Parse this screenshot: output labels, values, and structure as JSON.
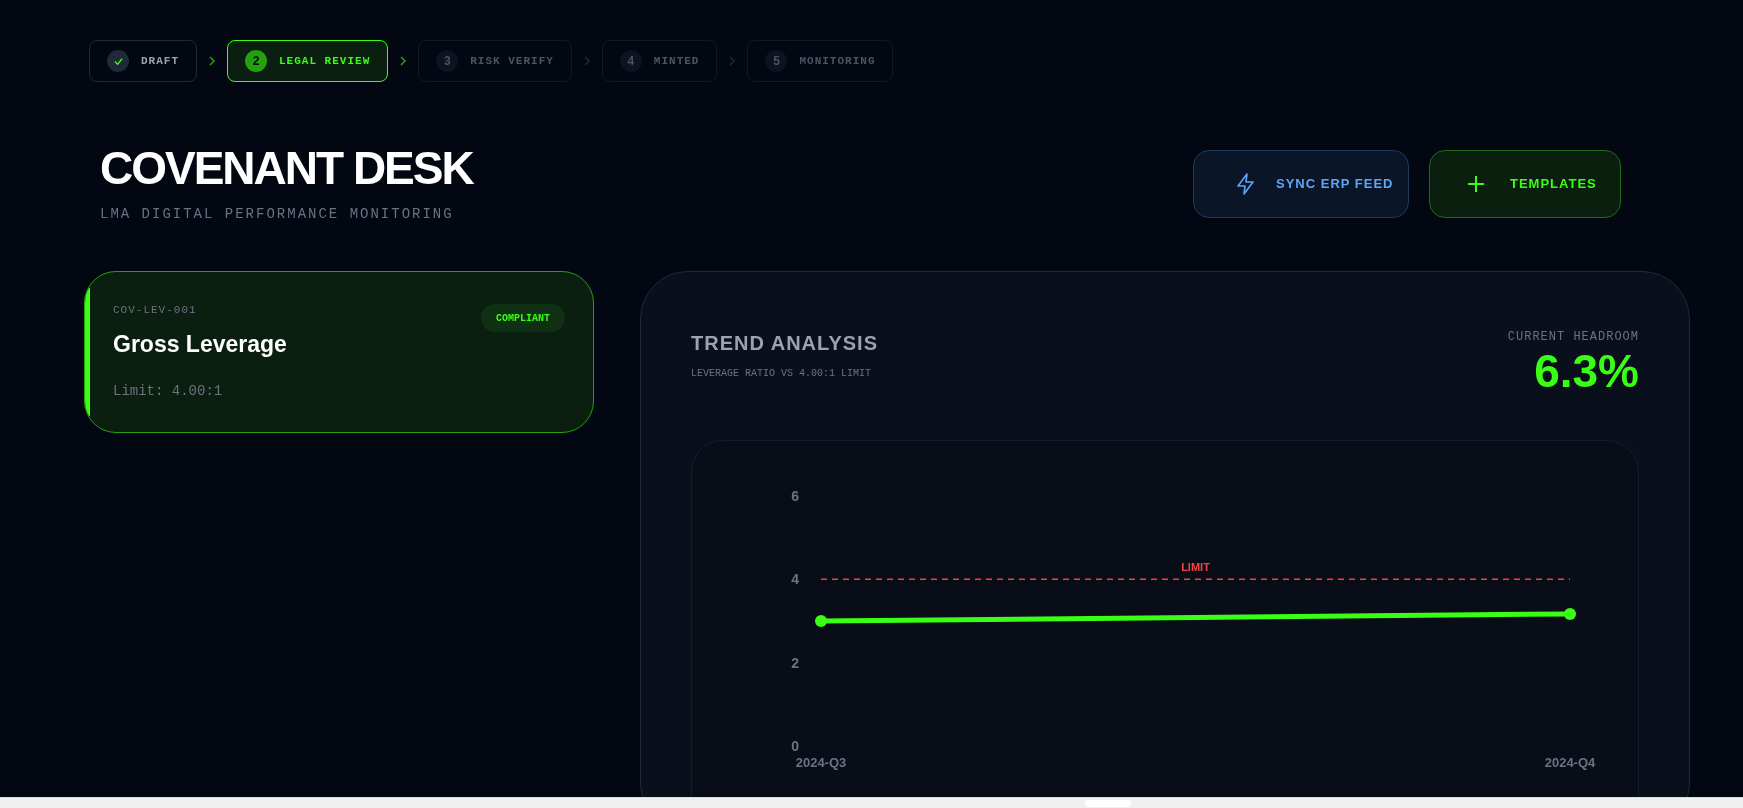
{
  "stepper": [
    {
      "label": "DRAFT",
      "completed": true,
      "selected": false
    },
    {
      "number": "2",
      "label": "LEGAL REVIEW",
      "completed": false,
      "selected": true
    },
    {
      "number": "3",
      "label": "RISK VERIFY",
      "completed": false,
      "selected": false
    },
    {
      "number": "4",
      "label": "MINTED",
      "completed": false,
      "selected": false
    },
    {
      "number": "5",
      "label": "MONITORING",
      "completed": false,
      "selected": false
    }
  ],
  "header": {
    "title": "COVENANT DESK",
    "subtitle": "LMA DIGITAL PERFORMANCE MONITORING",
    "buttons": [
      {
        "label": "SYNC ERP FEED",
        "kind": "sync"
      },
      {
        "label": "TEMPLATES",
        "kind": "add"
      }
    ]
  },
  "covenants": [
    {
      "code": "COV-LEV-001",
      "name": "Gross Leverage",
      "status": "COMPLIANT",
      "limit": "Limit: 4.00:1",
      "selected": true
    }
  ],
  "trend": {
    "title": "TREND ANALYSIS",
    "subtitle": "LEVERAGE RATIO VS 4.00:1 LIMIT",
    "headroom_label": "CURRENT HEADROOM",
    "headroom": "6.3%",
    "chart_data": {
      "type": "line",
      "categories": [
        "2024-Q3",
        "2024-Q4"
      ],
      "series": [
        {
          "color": "#39ff14",
          "marker": "circle",
          "values": [
            3.0,
            3.17
          ]
        }
      ],
      "ylim": [
        0,
        6
      ],
      "yticks": [
        0,
        2,
        4,
        6
      ],
      "ref_lines": [
        {
          "axis": "y",
          "value": 4,
          "label": "LIMIT"
        }
      ]
    }
  }
}
